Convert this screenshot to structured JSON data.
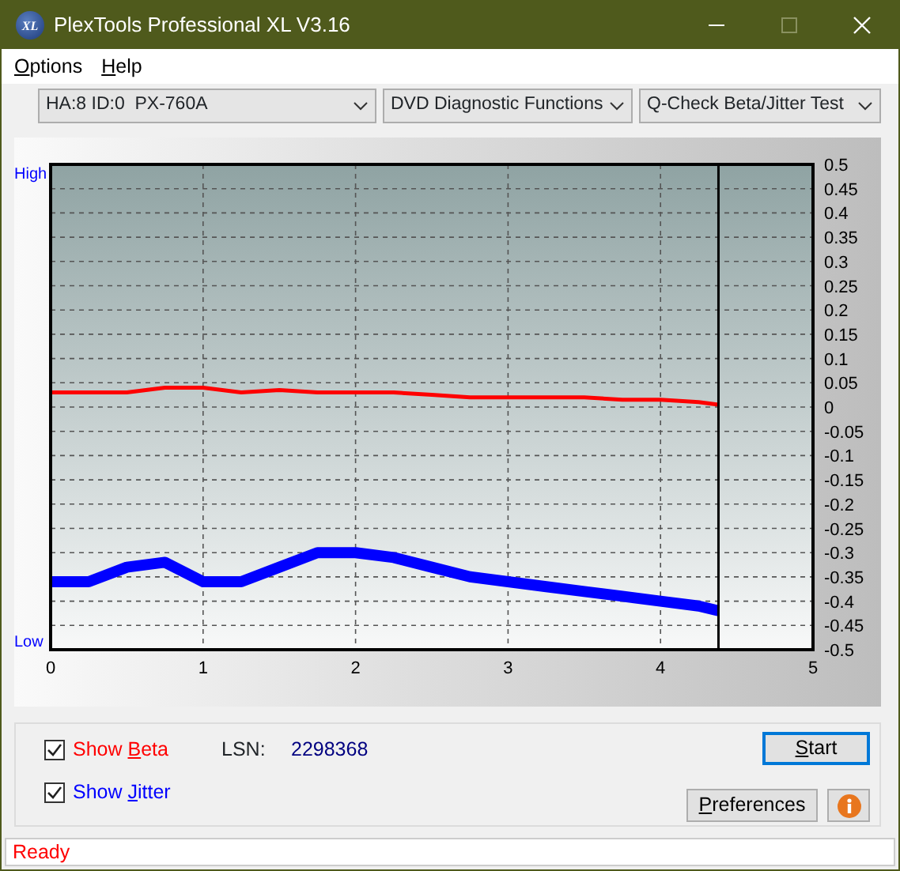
{
  "window": {
    "logo_text": "XL",
    "title": "PlexTools Professional XL V3.16",
    "controls": [
      {
        "kind": "minimize",
        "disabled": false
      },
      {
        "kind": "maximize",
        "disabled": true
      },
      {
        "kind": "close",
        "disabled": false
      }
    ]
  },
  "menu": [
    {
      "label": {
        "key": "O",
        "after": "ptions"
      }
    },
    {
      "label": {
        "key": "H",
        "after": "elp"
      }
    }
  ],
  "toolbar": {
    "dropdowns": [
      {
        "value": "HA:8 ID:0  PX-760A"
      },
      {
        "value": "DVD Diagnostic Functions"
      },
      {
        "value": "Q-Check Beta/Jitter Test"
      }
    ]
  },
  "chart": {
    "high_label": "High",
    "low_label": "Low",
    "chart_data": {
      "type": "line",
      "x": [
        0,
        0.25,
        0.5,
        0.75,
        1,
        1.25,
        1.5,
        1.75,
        2,
        2.25,
        2.5,
        2.75,
        3,
        3.25,
        3.5,
        3.75,
        4,
        4.25,
        4.38
      ],
      "series": [
        {
          "color": "#ff0000",
          "values": [
            0.03,
            0.03,
            0.03,
            0.04,
            0.04,
            0.03,
            0.035,
            0.03,
            0.03,
            0.03,
            0.025,
            0.02,
            0.02,
            0.02,
            0.02,
            0.015,
            0.015,
            0.01,
            0.005
          ]
        },
        {
          "color": "#0000ff",
          "values": [
            -0.36,
            -0.36,
            -0.33,
            -0.32,
            -0.36,
            -0.36,
            -0.33,
            -0.3,
            -0.3,
            -0.31,
            -0.33,
            -0.35,
            -0.36,
            -0.37,
            -0.38,
            -0.39,
            -0.4,
            -0.41,
            -0.42
          ]
        }
      ],
      "grid": true,
      "ref_lines": [
        {
          "axis": "x",
          "value": 4.38,
          "color": "#000000"
        }
      ],
      "xlim": [
        0,
        5
      ],
      "ylim": [
        -0.5,
        0.5
      ],
      "xticks": [
        0,
        1,
        2,
        3,
        4,
        5
      ],
      "yticks": [
        {
          "value": 0.5,
          "label": "0.5"
        },
        {
          "value": 0.45,
          "label": "0.45"
        },
        {
          "value": 0.4,
          "label": "0.4"
        },
        {
          "value": 0.35,
          "label": "0.35"
        },
        {
          "value": 0.3,
          "label": "0.3"
        },
        {
          "value": 0.25,
          "label": "0.25"
        },
        {
          "value": 0.2,
          "label": "0.2"
        },
        {
          "value": 0.15,
          "label": "0.15"
        },
        {
          "value": 0.1,
          "label": "0.1"
        },
        {
          "value": 0.05,
          "label": "0.05"
        },
        {
          "value": 0,
          "label": "0"
        },
        {
          "value": -0.05,
          "label": "-0.05"
        },
        {
          "value": -0.1,
          "label": "-0.1"
        },
        {
          "value": -0.15,
          "label": "-0.15"
        },
        {
          "value": -0.2,
          "label": "-0.2"
        },
        {
          "value": -0.25,
          "label": "-0.25"
        },
        {
          "value": -0.3,
          "label": "-0.3"
        },
        {
          "value": -0.35,
          "label": "-0.35"
        },
        {
          "value": -0.4,
          "label": "-0.4"
        },
        {
          "value": -0.45,
          "label": "-0.45"
        },
        {
          "value": -0.5,
          "label": "-0.5"
        }
      ]
    }
  },
  "options": [
    {
      "label": {
        "before": "Show ",
        "key": "B",
        "after": "eta"
      },
      "color": "#ff0000",
      "checked": true
    },
    {
      "label": {
        "before": "Show ",
        "key": "J",
        "after": "itter"
      },
      "color": "#0000ff",
      "checked": true
    }
  ],
  "lsn": {
    "label": "LSN:",
    "value": "2298368"
  },
  "buttons": [
    {
      "kind": "start",
      "label": {
        "key": "S",
        "after": "tart"
      },
      "default": true
    },
    {
      "kind": "preferences",
      "label": {
        "key": "P",
        "after": "references"
      },
      "default": false
    },
    {
      "kind": "info",
      "default": false
    }
  ],
  "status_bar": {
    "text": "Ready"
  }
}
